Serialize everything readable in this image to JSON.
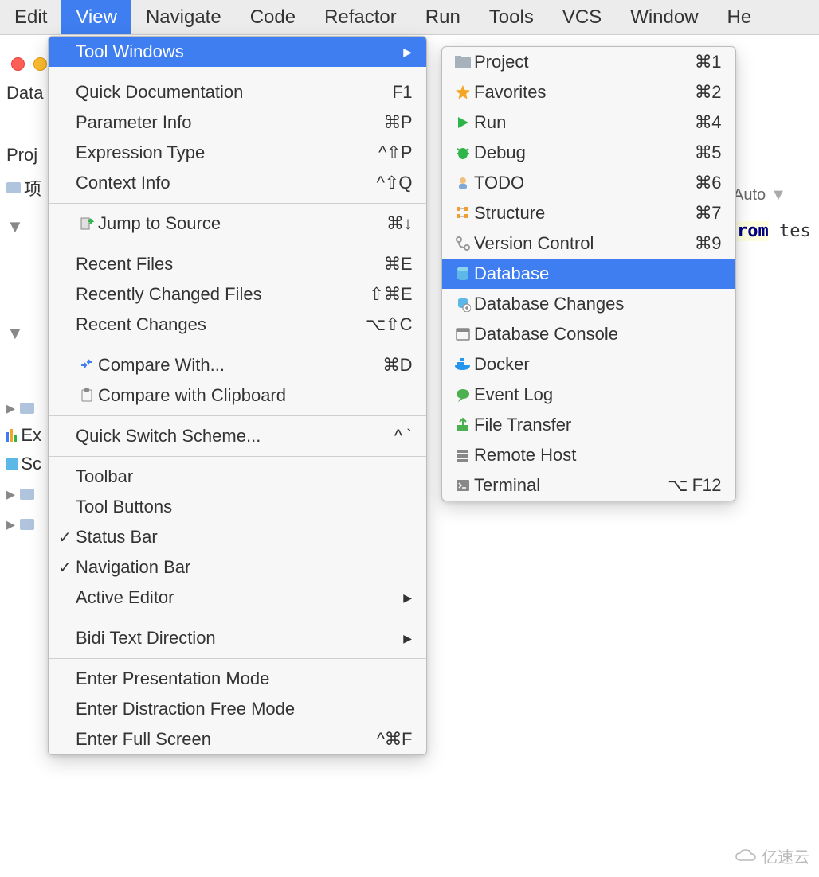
{
  "menubar": {
    "items": [
      "Edit",
      "View",
      "Navigate",
      "Code",
      "Refactor",
      "Run",
      "Tools",
      "VCS",
      "Window",
      "He"
    ],
    "active_index": 1
  },
  "left_strip": {
    "row1": "Data",
    "row2": "Proj",
    "row3": "项",
    "row4": "Ex",
    "row5": "Sc"
  },
  "view_menu": {
    "items": [
      {
        "label": "Tool Windows",
        "shortcut": "",
        "arrow": true,
        "highlighted": true
      },
      {
        "sep": true
      },
      {
        "label": "Quick Documentation",
        "shortcut": "F1"
      },
      {
        "label": "Parameter Info",
        "shortcut": "⌘P"
      },
      {
        "label": "Expression Type",
        "shortcut": "^⇧P"
      },
      {
        "label": "Context Info",
        "shortcut": "^⇧Q"
      },
      {
        "sep": true
      },
      {
        "label": "Jump to Source",
        "shortcut": "⌘↓",
        "icon": "jump-icon"
      },
      {
        "sep": true
      },
      {
        "label": "Recent Files",
        "shortcut": "⌘E"
      },
      {
        "label": "Recently Changed Files",
        "shortcut": "⇧⌘E"
      },
      {
        "label": "Recent Changes",
        "shortcut": "⌥⇧C"
      },
      {
        "sep": true
      },
      {
        "label": "Compare With...",
        "shortcut": "⌘D",
        "icon": "compare-icon"
      },
      {
        "label": "Compare with Clipboard",
        "shortcut": "",
        "icon": "clipboard-compare-icon"
      },
      {
        "sep": true
      },
      {
        "label": "Quick Switch Scheme...",
        "shortcut": "^ `"
      },
      {
        "sep": true
      },
      {
        "label": "Toolbar"
      },
      {
        "label": "Tool Buttons"
      },
      {
        "label": "Status Bar",
        "checked": true
      },
      {
        "label": "Navigation Bar",
        "checked": true
      },
      {
        "label": "Active Editor",
        "arrow": true
      },
      {
        "sep": true
      },
      {
        "label": "Bidi Text Direction",
        "arrow": true
      },
      {
        "sep": true
      },
      {
        "label": "Enter Presentation Mode"
      },
      {
        "label": "Enter Distraction Free Mode"
      },
      {
        "label": "Enter Full Screen",
        "shortcut": "^⌘F"
      }
    ]
  },
  "tool_windows_submenu": {
    "items": [
      {
        "label": "Project",
        "shortcut": "⌘1",
        "icon": "project-icon",
        "color": "#a7b1bb"
      },
      {
        "label": "Favorites",
        "shortcut": "⌘2",
        "icon": "star-icon",
        "color": "#f5a623"
      },
      {
        "label": "Run",
        "shortcut": "⌘4",
        "icon": "play-icon",
        "color": "#2db54a"
      },
      {
        "label": "Debug",
        "shortcut": "⌘5",
        "icon": "bug-icon",
        "color": "#2db54a"
      },
      {
        "label": "TODO",
        "shortcut": "⌘6",
        "icon": "todo-icon",
        "color": "#888"
      },
      {
        "label": "Structure",
        "shortcut": "⌘7",
        "icon": "structure-icon",
        "color": "#f0a030"
      },
      {
        "label": "Version Control",
        "shortcut": "⌘9",
        "icon": "vcs-icon",
        "color": "#999"
      },
      {
        "label": "Database",
        "shortcut": "",
        "icon": "database-icon",
        "highlighted": true,
        "color": "#5cb8e6"
      },
      {
        "label": "Database Changes",
        "shortcut": "",
        "icon": "db-changes-icon",
        "color": "#5cb8e6"
      },
      {
        "label": "Database Console",
        "shortcut": "",
        "icon": "console-icon",
        "color": "#888"
      },
      {
        "label": "Docker",
        "shortcut": "",
        "icon": "docker-icon",
        "color": "#2496ed"
      },
      {
        "label": "Event Log",
        "shortcut": "",
        "icon": "event-log-icon",
        "color": "#4caf50"
      },
      {
        "label": "File Transfer",
        "shortcut": "",
        "icon": "transfer-icon",
        "color": "#4caf50"
      },
      {
        "label": "Remote Host",
        "shortcut": "",
        "icon": "remote-icon",
        "color": "#888"
      },
      {
        "label": "Terminal",
        "shortcut": "⌥ F12",
        "icon": "terminal-icon",
        "color": "#888"
      }
    ]
  },
  "background": {
    "auto_label": "Auto",
    "code_kw": "rom",
    "code_rest": " tes"
  },
  "watermark": "亿速云"
}
